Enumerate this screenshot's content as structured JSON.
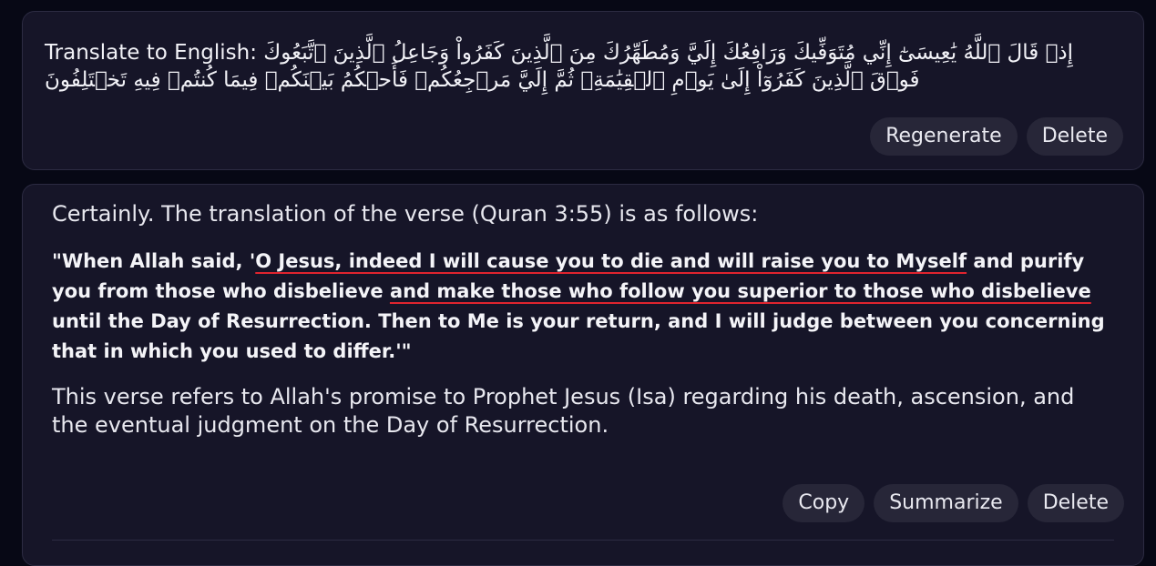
{
  "user_message": {
    "label": "Translate to English:",
    "arabic_text": "إِذۡ قَالَ ٱللَّهُ يَٰعِيسَىٰٓ إِنِّي مُتَوَفِّيكَ وَرَافِعُكَ إِلَيَّ وَمُطَهِّرُكَ مِنَ ٱلَّذِينَ كَفَرُواْ وَجَاعِلُ ٱلَّذِينَ ٱتَّبَعُوكَ فَوۡقَ ٱلَّذِينَ كَفَرُوٓاْ إِلَىٰ يَوۡمِ ٱلۡقِيَٰمَةِۖ ثُمَّ إِلَيَّ مَرۡجِعُكُمۡ فَأَحۡكُمُ بَيۡنَكُمۡ فِيمَا كُنتُمۡ فِيهِ تَخۡتَلِفُونَ",
    "buttons": {
      "regenerate": "Regenerate",
      "delete": "Delete"
    }
  },
  "assistant_message": {
    "intro": "Certainly. The translation of the verse (Quran 3:55) is as follows:",
    "quote": {
      "part1": "\"When Allah said, '",
      "part2_underlined": "O Jesus, indeed I will cause you to die and will raise you to Myself",
      "part3": " and purify you from those who disbelieve ",
      "part4_underlined": "and make those who follow you superior to those who disbelieve",
      "part5": " until the Day of Resurrection. Then to Me is your return, and I will judge between you concerning that in which you used to differ.'\""
    },
    "explanation": "This verse refers to Allah's promise to Prophet Jesus (Isa) regarding his death, ascension, and the eventual judgment on the Day of Resurrection.",
    "buttons": {
      "copy": "Copy",
      "summarize": "Summarize",
      "delete": "Delete"
    }
  },
  "colors": {
    "background": "#070815",
    "card": "#161528",
    "button": "#272638",
    "underline": "#e0242e"
  }
}
